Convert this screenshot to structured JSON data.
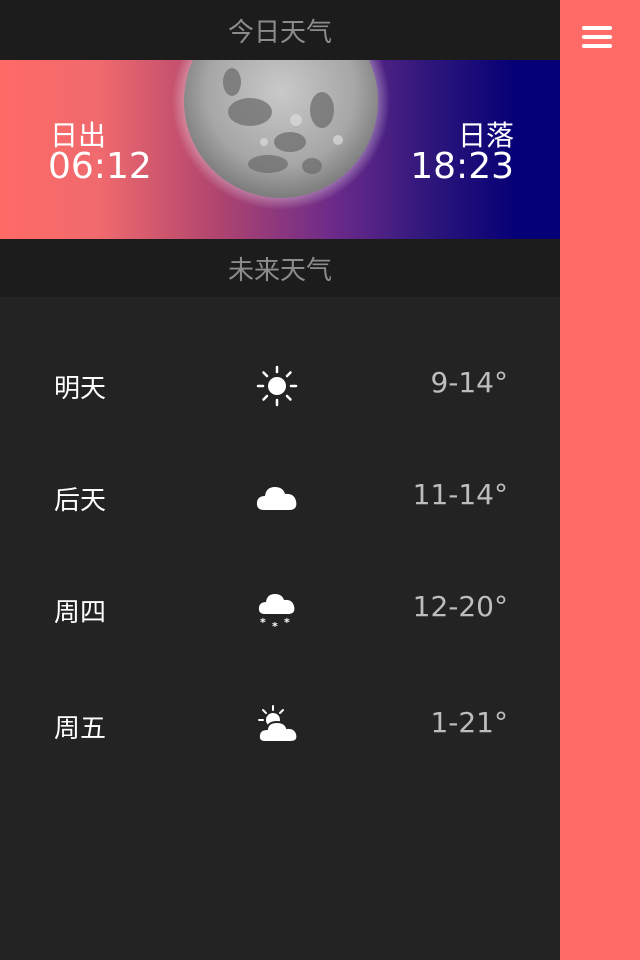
{
  "header": {
    "today_title": "今日天气",
    "future_title": "未来天气"
  },
  "sun": {
    "sunrise_label": "日出",
    "sunrise_time": "06:12",
    "sunset_label": "日落",
    "sunset_time": "18:23"
  },
  "forecast": [
    {
      "day": "明天",
      "icon": "sun-icon",
      "temp": "9-14°"
    },
    {
      "day": "后天",
      "icon": "cloud-icon",
      "temp": "11-14°"
    },
    {
      "day": "周四",
      "icon": "snow-icon",
      "temp": "12-20°"
    },
    {
      "day": "周五",
      "icon": "partly-cloudy-icon",
      "temp": "1-21°"
    }
  ],
  "colors": {
    "accent": "#FF6B66",
    "background": "#232323",
    "header_bg": "#1c1c1c"
  }
}
